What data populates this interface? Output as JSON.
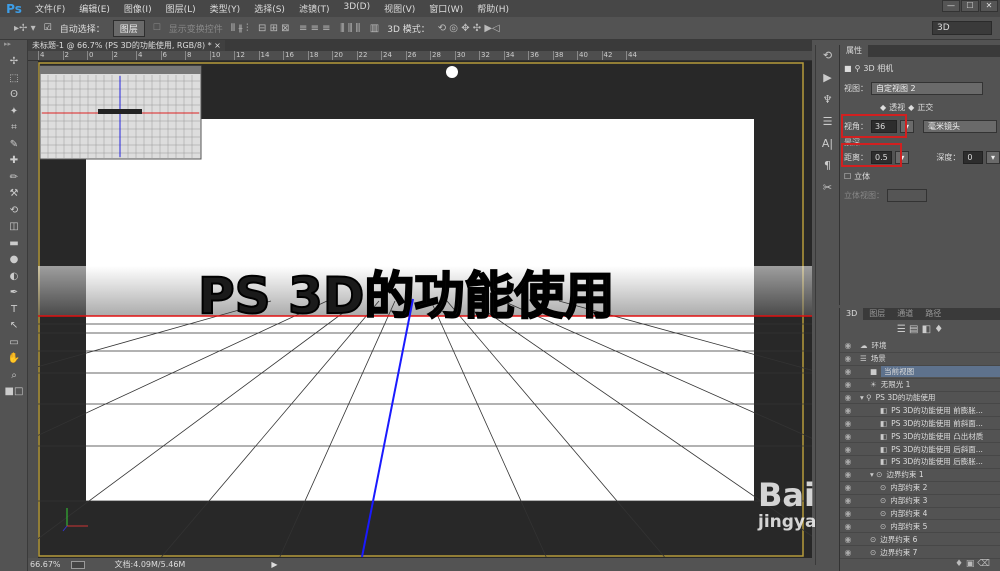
{
  "app": {
    "logo": "Ps"
  },
  "menu": [
    "文件(F)",
    "编辑(E)",
    "图像(I)",
    "图层(L)",
    "类型(Y)",
    "选择(S)",
    "滤镜(T)",
    "3D(D)",
    "视图(V)",
    "窗口(W)",
    "帮助(H)"
  ],
  "window_buttons": [
    "—",
    "☐",
    "✕"
  ],
  "options": {
    "auto_select_label": "自动选择：",
    "auto_select_checked": true,
    "auto_select_value": "图层",
    "show_transform": "显示变换控件",
    "mode_3d_label": "3D 模式：",
    "workspace": "3D"
  },
  "document_tab": {
    "title": "未标题-1 @ 66.7% (PS 3D的功能使用, RGB/8) *",
    "close": "×"
  },
  "ruler_labels": [
    "4",
    "2",
    "0",
    "2",
    "4",
    "6",
    "8",
    "10",
    "12",
    "14",
    "16",
    "18",
    "20",
    "22",
    "24",
    "26",
    "28",
    "30",
    "32",
    "34",
    "36",
    "38",
    "40",
    "42",
    "44"
  ],
  "canvas": {
    "text": "PS 3D的功能使用"
  },
  "status": {
    "zoom": "66.67%",
    "doc": "文档:4.09M/5.46M"
  },
  "properties": {
    "tab": "属性",
    "title": "3D 相机",
    "view_label": "视图：",
    "view_value": "自定视图 2",
    "perspective": "透视",
    "orthographic": "正交",
    "fov_label": "视角：",
    "fov_value": "36",
    "fov_unit": "毫米镜头",
    "dof_section": "景深",
    "distance_label": "距离：",
    "distance_value": "0.5",
    "depth_label": "深度：",
    "depth_value": "0",
    "stereo_label": "立体",
    "stereo_view_label": "立体视图："
  },
  "panel3d": {
    "tabs": [
      "3D",
      "图层",
      "通道",
      "路径"
    ],
    "items": [
      {
        "label": "环境",
        "indent": 0,
        "icon": "☁"
      },
      {
        "label": "场景",
        "indent": 0,
        "icon": "☰"
      },
      {
        "label": "当前视图",
        "indent": 1,
        "icon": "■",
        "selected": true
      },
      {
        "label": "无限光 1",
        "indent": 1,
        "icon": "☀"
      },
      {
        "label": "PS 3D的功能使用",
        "indent": 0,
        "icon": "▾ ⚲"
      },
      {
        "label": "PS 3D的功能使用 前膨胀...",
        "indent": 2,
        "icon": "◧"
      },
      {
        "label": "PS 3D的功能使用 前斜面...",
        "indent": 2,
        "icon": "◧"
      },
      {
        "label": "PS 3D的功能使用 凸出材质",
        "indent": 2,
        "icon": "◧"
      },
      {
        "label": "PS 3D的功能使用 后斜面...",
        "indent": 2,
        "icon": "◧"
      },
      {
        "label": "PS 3D的功能使用 后膨胀...",
        "indent": 2,
        "icon": "◧"
      },
      {
        "label": "边界约束 1",
        "indent": 1,
        "icon": "▾ ⊙"
      },
      {
        "label": "内部约束 2",
        "indent": 2,
        "icon": "⊙"
      },
      {
        "label": "内部约束 3",
        "indent": 2,
        "icon": "⊙"
      },
      {
        "label": "内部约束 4",
        "indent": 2,
        "icon": "⊙"
      },
      {
        "label": "内部约束 5",
        "indent": 2,
        "icon": "⊙"
      },
      {
        "label": "边界约束 6",
        "indent": 1,
        "icon": "⊙"
      },
      {
        "label": "边界约束 7",
        "indent": 1,
        "icon": "⊙"
      }
    ]
  },
  "watermark": {
    "brand": "Bai du 经验",
    "url": "jingyan.baidu.com"
  },
  "colors": {
    "highlight": "#d12020",
    "axis_blue": "#1a1aff",
    "selection": "#5e728d"
  }
}
